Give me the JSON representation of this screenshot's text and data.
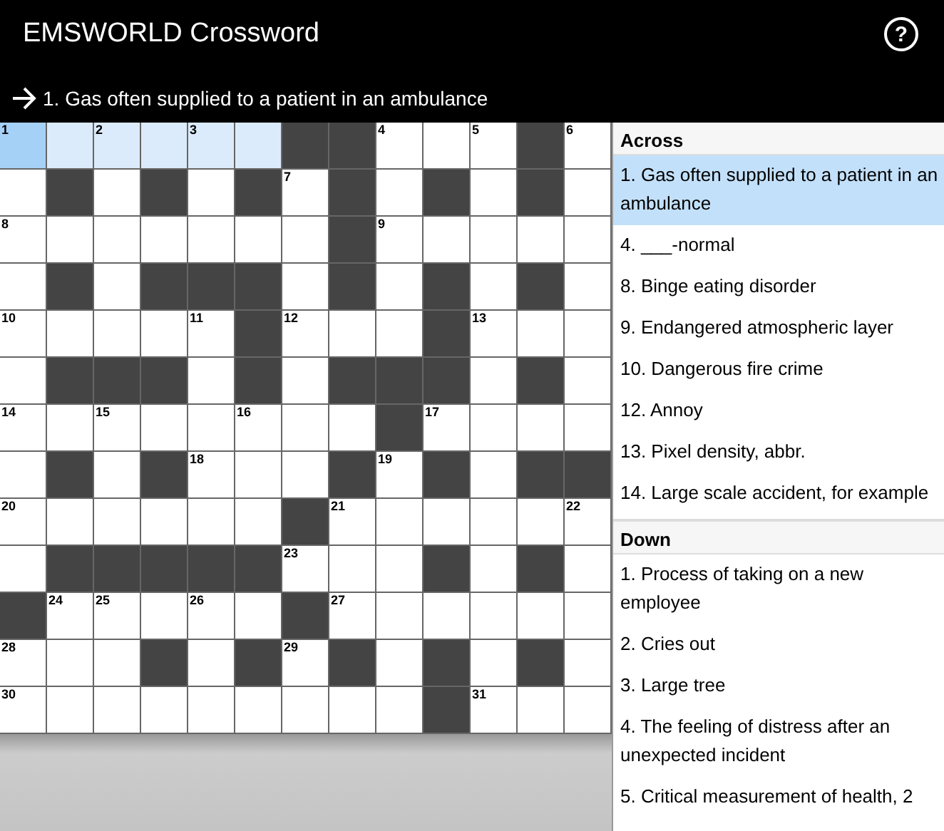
{
  "header": {
    "title": "EMSWORLD Crossword",
    "help_button": "?"
  },
  "current_clue": {
    "text": "1. Gas often supplied to a patient in an ambulance"
  },
  "grid": {
    "rows": [
      [
        {
          "kind": "open",
          "number": "1",
          "selected": true,
          "in_word": true
        },
        {
          "kind": "open",
          "selected": false,
          "in_word": true
        },
        {
          "kind": "open",
          "number": "2",
          "selected": false,
          "in_word": true
        },
        {
          "kind": "open",
          "selected": false,
          "in_word": true
        },
        {
          "kind": "open",
          "number": "3",
          "selected": false,
          "in_word": true
        },
        {
          "kind": "open",
          "selected": false,
          "in_word": true
        },
        {
          "kind": "block"
        },
        {
          "kind": "block"
        },
        {
          "kind": "open",
          "number": "4",
          "selected": false,
          "in_word": false
        },
        {
          "kind": "open",
          "selected": false,
          "in_word": false
        },
        {
          "kind": "open",
          "number": "5",
          "selected": false,
          "in_word": false
        },
        {
          "kind": "block"
        },
        {
          "kind": "open",
          "number": "6",
          "selected": false,
          "in_word": false
        }
      ],
      [
        {
          "kind": "open",
          "selected": false,
          "in_word": false
        },
        {
          "kind": "block"
        },
        {
          "kind": "open",
          "selected": false,
          "in_word": false
        },
        {
          "kind": "block"
        },
        {
          "kind": "open",
          "selected": false,
          "in_word": false
        },
        {
          "kind": "block"
        },
        {
          "kind": "open",
          "number": "7",
          "selected": false,
          "in_word": false
        },
        {
          "kind": "block"
        },
        {
          "kind": "open",
          "selected": false,
          "in_word": false
        },
        {
          "kind": "block"
        },
        {
          "kind": "open",
          "selected": false,
          "in_word": false
        },
        {
          "kind": "block"
        },
        {
          "kind": "open",
          "selected": false,
          "in_word": false
        }
      ],
      [
        {
          "kind": "open",
          "number": "8",
          "selected": false,
          "in_word": false
        },
        {
          "kind": "open",
          "selected": false,
          "in_word": false
        },
        {
          "kind": "open",
          "selected": false,
          "in_word": false
        },
        {
          "kind": "open",
          "selected": false,
          "in_word": false
        },
        {
          "kind": "open",
          "selected": false,
          "in_word": false
        },
        {
          "kind": "open",
          "selected": false,
          "in_word": false
        },
        {
          "kind": "open",
          "selected": false,
          "in_word": false
        },
        {
          "kind": "block"
        },
        {
          "kind": "open",
          "number": "9",
          "selected": false,
          "in_word": false
        },
        {
          "kind": "open",
          "selected": false,
          "in_word": false
        },
        {
          "kind": "open",
          "selected": false,
          "in_word": false
        },
        {
          "kind": "open",
          "selected": false,
          "in_word": false
        },
        {
          "kind": "open",
          "selected": false,
          "in_word": false
        }
      ],
      [
        {
          "kind": "open",
          "selected": false,
          "in_word": false
        },
        {
          "kind": "block"
        },
        {
          "kind": "open",
          "selected": false,
          "in_word": false
        },
        {
          "kind": "block"
        },
        {
          "kind": "block"
        },
        {
          "kind": "block"
        },
        {
          "kind": "open",
          "selected": false,
          "in_word": false
        },
        {
          "kind": "block"
        },
        {
          "kind": "open",
          "selected": false,
          "in_word": false
        },
        {
          "kind": "block"
        },
        {
          "kind": "open",
          "selected": false,
          "in_word": false
        },
        {
          "kind": "block"
        },
        {
          "kind": "open",
          "selected": false,
          "in_word": false
        }
      ],
      [
        {
          "kind": "open",
          "number": "10",
          "selected": false,
          "in_word": false
        },
        {
          "kind": "open",
          "selected": false,
          "in_word": false
        },
        {
          "kind": "open",
          "selected": false,
          "in_word": false
        },
        {
          "kind": "open",
          "selected": false,
          "in_word": false
        },
        {
          "kind": "open",
          "number": "11",
          "selected": false,
          "in_word": false
        },
        {
          "kind": "block"
        },
        {
          "kind": "open",
          "number": "12",
          "selected": false,
          "in_word": false
        },
        {
          "kind": "open",
          "selected": false,
          "in_word": false
        },
        {
          "kind": "open",
          "selected": false,
          "in_word": false
        },
        {
          "kind": "block"
        },
        {
          "kind": "open",
          "number": "13",
          "selected": false,
          "in_word": false
        },
        {
          "kind": "open",
          "selected": false,
          "in_word": false
        },
        {
          "kind": "open",
          "selected": false,
          "in_word": false
        }
      ],
      [
        {
          "kind": "open",
          "selected": false,
          "in_word": false
        },
        {
          "kind": "block"
        },
        {
          "kind": "block"
        },
        {
          "kind": "block"
        },
        {
          "kind": "open",
          "selected": false,
          "in_word": false
        },
        {
          "kind": "block"
        },
        {
          "kind": "open",
          "selected": false,
          "in_word": false
        },
        {
          "kind": "block"
        },
        {
          "kind": "block"
        },
        {
          "kind": "block"
        },
        {
          "kind": "open",
          "selected": false,
          "in_word": false
        },
        {
          "kind": "block"
        },
        {
          "kind": "open",
          "selected": false,
          "in_word": false
        }
      ],
      [
        {
          "kind": "open",
          "number": "14",
          "selected": false,
          "in_word": false
        },
        {
          "kind": "open",
          "selected": false,
          "in_word": false
        },
        {
          "kind": "open",
          "number": "15",
          "selected": false,
          "in_word": false
        },
        {
          "kind": "open",
          "selected": false,
          "in_word": false
        },
        {
          "kind": "open",
          "selected": false,
          "in_word": false
        },
        {
          "kind": "open",
          "number": "16",
          "selected": false,
          "in_word": false
        },
        {
          "kind": "open",
          "selected": false,
          "in_word": false
        },
        {
          "kind": "open",
          "selected": false,
          "in_word": false
        },
        {
          "kind": "block"
        },
        {
          "kind": "open",
          "number": "17",
          "selected": false,
          "in_word": false
        },
        {
          "kind": "open",
          "selected": false,
          "in_word": false
        },
        {
          "kind": "open",
          "selected": false,
          "in_word": false
        },
        {
          "kind": "open",
          "selected": false,
          "in_word": false
        }
      ],
      [
        {
          "kind": "open",
          "selected": false,
          "in_word": false
        },
        {
          "kind": "block"
        },
        {
          "kind": "open",
          "selected": false,
          "in_word": false
        },
        {
          "kind": "block"
        },
        {
          "kind": "open",
          "number": "18",
          "selected": false,
          "in_word": false
        },
        {
          "kind": "open",
          "selected": false,
          "in_word": false
        },
        {
          "kind": "open",
          "selected": false,
          "in_word": false
        },
        {
          "kind": "block"
        },
        {
          "kind": "open",
          "number": "19",
          "selected": false,
          "in_word": false
        },
        {
          "kind": "block"
        },
        {
          "kind": "open",
          "selected": false,
          "in_word": false
        },
        {
          "kind": "block"
        },
        {
          "kind": "block"
        }
      ],
      [
        {
          "kind": "open",
          "number": "20",
          "selected": false,
          "in_word": false
        },
        {
          "kind": "open",
          "selected": false,
          "in_word": false
        },
        {
          "kind": "open",
          "selected": false,
          "in_word": false
        },
        {
          "kind": "open",
          "selected": false,
          "in_word": false
        },
        {
          "kind": "open",
          "selected": false,
          "in_word": false
        },
        {
          "kind": "open",
          "selected": false,
          "in_word": false
        },
        {
          "kind": "block"
        },
        {
          "kind": "open",
          "number": "21",
          "selected": false,
          "in_word": false
        },
        {
          "kind": "open",
          "selected": false,
          "in_word": false
        },
        {
          "kind": "open",
          "selected": false,
          "in_word": false
        },
        {
          "kind": "open",
          "selected": false,
          "in_word": false
        },
        {
          "kind": "open",
          "selected": false,
          "in_word": false
        },
        {
          "kind": "open",
          "number": "22",
          "selected": false,
          "in_word": false
        }
      ],
      [
        {
          "kind": "open",
          "selected": false,
          "in_word": false
        },
        {
          "kind": "block"
        },
        {
          "kind": "block"
        },
        {
          "kind": "block"
        },
        {
          "kind": "block"
        },
        {
          "kind": "block"
        },
        {
          "kind": "open",
          "number": "23",
          "selected": false,
          "in_word": false
        },
        {
          "kind": "open",
          "selected": false,
          "in_word": false
        },
        {
          "kind": "open",
          "selected": false,
          "in_word": false
        },
        {
          "kind": "block"
        },
        {
          "kind": "open",
          "selected": false,
          "in_word": false
        },
        {
          "kind": "block"
        },
        {
          "kind": "open",
          "selected": false,
          "in_word": false
        }
      ],
      [
        {
          "kind": "block"
        },
        {
          "kind": "open",
          "number": "24",
          "selected": false,
          "in_word": false
        },
        {
          "kind": "open",
          "number": "25",
          "selected": false,
          "in_word": false
        },
        {
          "kind": "open",
          "selected": false,
          "in_word": false
        },
        {
          "kind": "open",
          "number": "26",
          "selected": false,
          "in_word": false
        },
        {
          "kind": "open",
          "selected": false,
          "in_word": false
        },
        {
          "kind": "block"
        },
        {
          "kind": "open",
          "number": "27",
          "selected": false,
          "in_word": false
        },
        {
          "kind": "open",
          "selected": false,
          "in_word": false
        },
        {
          "kind": "open",
          "selected": false,
          "in_word": false
        },
        {
          "kind": "open",
          "selected": false,
          "in_word": false
        },
        {
          "kind": "open",
          "selected": false,
          "in_word": false
        },
        {
          "kind": "open",
          "selected": false,
          "in_word": false
        }
      ],
      [
        {
          "kind": "open",
          "number": "28",
          "selected": false,
          "in_word": false
        },
        {
          "kind": "open",
          "selected": false,
          "in_word": false
        },
        {
          "kind": "open",
          "selected": false,
          "in_word": false
        },
        {
          "kind": "block"
        },
        {
          "kind": "open",
          "selected": false,
          "in_word": false
        },
        {
          "kind": "block"
        },
        {
          "kind": "open",
          "number": "29",
          "selected": false,
          "in_word": false
        },
        {
          "kind": "block"
        },
        {
          "kind": "open",
          "selected": false,
          "in_word": false
        },
        {
          "kind": "block"
        },
        {
          "kind": "open",
          "selected": false,
          "in_word": false
        },
        {
          "kind": "block"
        },
        {
          "kind": "open",
          "selected": false,
          "in_word": false
        }
      ],
      [
        {
          "kind": "open",
          "number": "30",
          "selected": false,
          "in_word": false
        },
        {
          "kind": "open",
          "selected": false,
          "in_word": false
        },
        {
          "kind": "open",
          "selected": false,
          "in_word": false
        },
        {
          "kind": "open",
          "selected": false,
          "in_word": false
        },
        {
          "kind": "open",
          "selected": false,
          "in_word": false
        },
        {
          "kind": "open",
          "selected": false,
          "in_word": false
        },
        {
          "kind": "open",
          "selected": false,
          "in_word": false
        },
        {
          "kind": "open",
          "selected": false,
          "in_word": false
        },
        {
          "kind": "open",
          "selected": false,
          "in_word": false
        },
        {
          "kind": "block"
        },
        {
          "kind": "open",
          "number": "31",
          "selected": false,
          "in_word": false
        },
        {
          "kind": "open",
          "selected": false,
          "in_word": false
        },
        {
          "kind": "open",
          "selected": false,
          "in_word": false
        }
      ]
    ]
  },
  "clue_lists": [
    {
      "heading": "Across",
      "clues": [
        {
          "text": "1. Gas often supplied to a patient in an ambulance",
          "selected": true
        },
        {
          "text": "4. ___-normal",
          "selected": false
        },
        {
          "text": "8. Binge eating disorder",
          "selected": false
        },
        {
          "text": "9. Endangered atmospheric layer",
          "selected": false
        },
        {
          "text": "10. Dangerous fire crime",
          "selected": false
        },
        {
          "text": "12. Annoy",
          "selected": false
        },
        {
          "text": "13. Pixel density, abbr.",
          "selected": false
        },
        {
          "text": "14. Large scale accident, for example",
          "selected": false
        }
      ]
    },
    {
      "heading": "Down",
      "clues": [
        {
          "text": "1. Process of taking on a new employee",
          "selected": false
        },
        {
          "text": "2. Cries out",
          "selected": false
        },
        {
          "text": "3. Large tree",
          "selected": false
        },
        {
          "text": "4. The feeling of distress after an unexpected incident",
          "selected": false
        },
        {
          "text": "5. Critical measurement of health, 2",
          "selected": false
        }
      ]
    }
  ]
}
